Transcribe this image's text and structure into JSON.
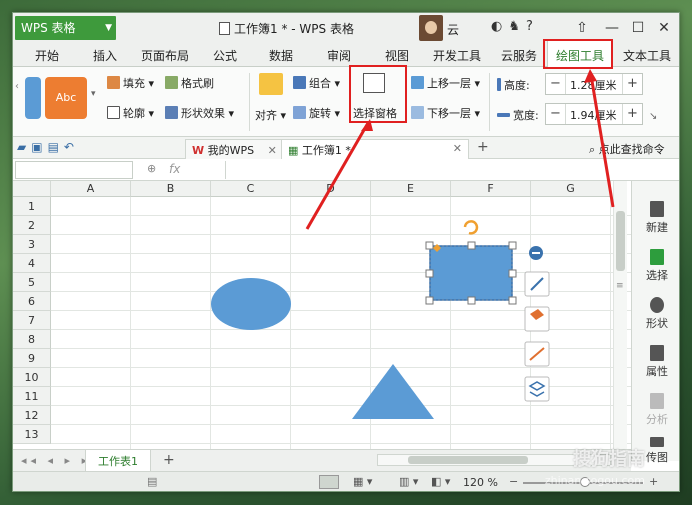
{
  "app": {
    "menu_button": "WPS 表格",
    "window_title": "工作簿1 * - WPS 表格",
    "user": "云"
  },
  "ribbon_tabs": [
    "开始",
    "插入",
    "页面布局",
    "公式",
    "数据",
    "审阅",
    "视图",
    "开发工具",
    "云服务",
    "绘图工具",
    "文本工具"
  ],
  "active_tab": "绘图工具",
  "ribbon": {
    "shape_style_label": "Abc",
    "fill": "填充",
    "format_brush": "格式刷",
    "outline": "轮廓",
    "shape_effect": "形状效果",
    "align": "对齐",
    "group": "组合",
    "rotate": "旋转",
    "selection_pane": "选择窗格",
    "bring_forward": "上移一层",
    "send_backward": "下移一层",
    "height_label": "高度:",
    "height_value": "1.28厘米",
    "width_label": "宽度:",
    "width_value": "1.94厘米"
  },
  "doc_tabs": {
    "mywps": "我的WPS",
    "workbook": "工作簿1 *",
    "search": "点此查找命令"
  },
  "formula_bar": {
    "fx": "fx"
  },
  "columns": [
    "A",
    "B",
    "C",
    "D",
    "E",
    "F",
    "G"
  ],
  "rows": [
    "1",
    "2",
    "3",
    "4",
    "5",
    "6",
    "7",
    "8",
    "9",
    "10",
    "11",
    "12",
    "13"
  ],
  "sidebar": [
    "新建",
    "选择",
    "形状",
    "属性",
    "分析",
    "传图"
  ],
  "sheet_tab": "工作表1",
  "status": {
    "zoom": "120 %"
  },
  "watermark": {
    "brand": "搜狗指南",
    "url": "zhinan.sogou.com"
  },
  "colors": {
    "accent_green": "#3e9a3c",
    "shape_blue": "#5b9bd5",
    "highlight_red": "#e02020"
  }
}
